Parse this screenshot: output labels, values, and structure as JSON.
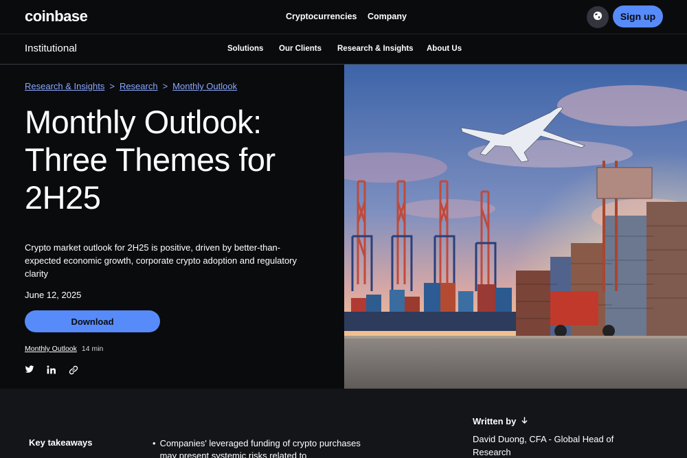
{
  "header": {
    "logo": "coinbase",
    "nav": [
      "Cryptocurrencies",
      "Company"
    ],
    "signup_label": "Sign up",
    "globe_icon": "globe-icon"
  },
  "subnav": {
    "brand": "Institutional",
    "items": [
      "Solutions",
      "Our Clients",
      "Research & Insights",
      "About Us"
    ]
  },
  "breadcrumb": {
    "items": [
      "Research & Insights",
      "Research",
      "Monthly Outlook"
    ],
    "separator": ">"
  },
  "hero": {
    "title": "Monthly Outlook: Three Themes for 2H25",
    "description": "Crypto market outlook for 2H25 is positive, driven by better-than-expected economic growth, corporate crypto adoption and regulatory clarity",
    "date": "June 12, 2025",
    "download_label": "Download",
    "tag": "Monthly Outlook",
    "read_time": "14 min",
    "share_icons": [
      "twitter-icon",
      "linkedin-icon",
      "link-icon"
    ]
  },
  "takeaways": {
    "label": "Key takeaways",
    "first_item": "Companies' leveraged funding of crypto purchases may present systemic risks related to"
  },
  "author": {
    "label": "Written by",
    "name": "David Duong, CFA - Global Head of Research"
  },
  "colors": {
    "background": "#0a0b0d",
    "accent": "#578bfa",
    "link": "#8aa8ff",
    "lower_bg": "#141519"
  }
}
